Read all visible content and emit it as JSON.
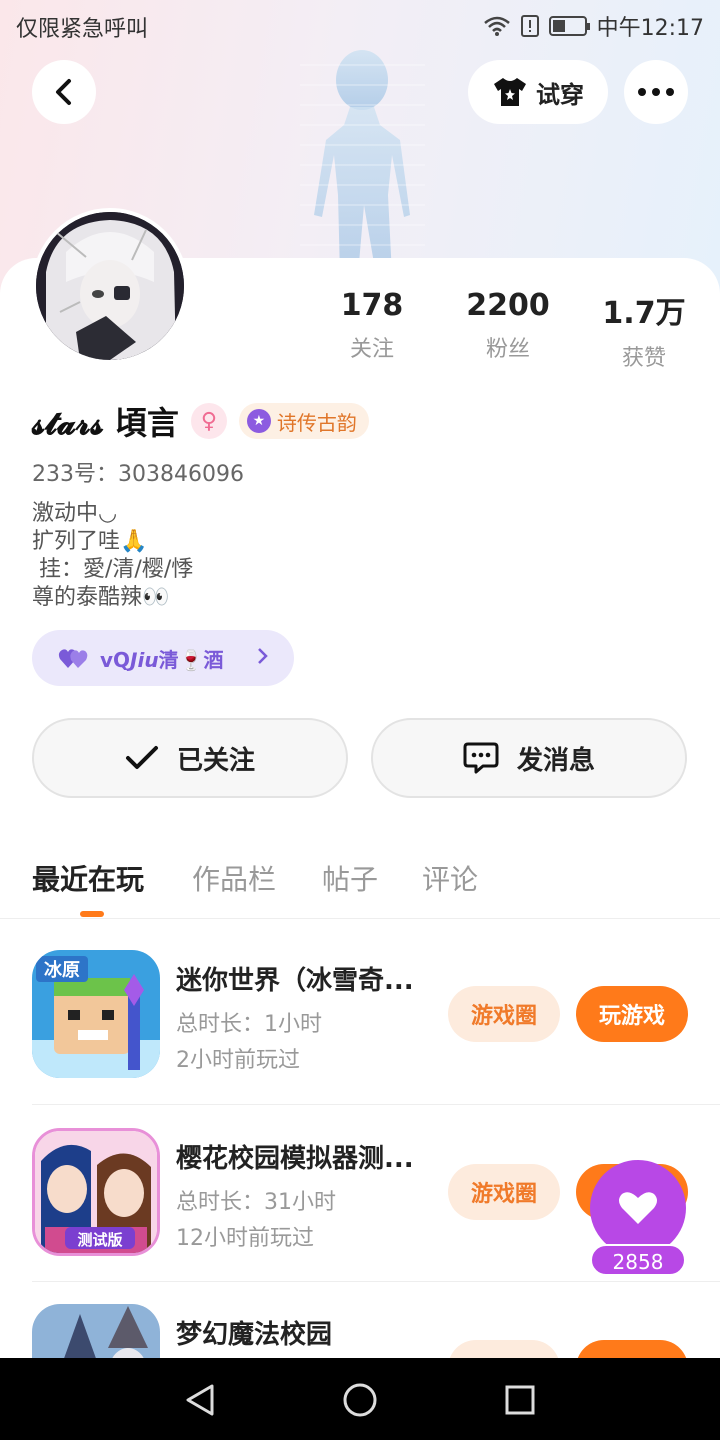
{
  "status_bar": {
    "carrier": "仅限紧急呼叫",
    "time": "中午12:17"
  },
  "header": {
    "tryon_label": "试穿",
    "back_icon": "back-chevron-icon",
    "more_icon": "more-dots-icon",
    "tryon_icon": "tshirt-icon"
  },
  "profile": {
    "stats": [
      {
        "value": "178",
        "label": "关注"
      },
      {
        "value": "2200",
        "label": "粉丝"
      },
      {
        "value": "1.7万",
        "label": "获赞"
      }
    ],
    "name": "𝓼𝓽𝓪𝓻𝓼 頃言",
    "gender_symbol": "♀",
    "title_badge": "诗传古韵",
    "uid": "233号：303846096",
    "bio": "激动中◡\n扩列了哇🙏\n 挂：愛/清/樱/悸\n尊的泰酷辣👀",
    "cp_name": "vQ𝙅𝙞𝙪清🍷酒"
  },
  "actions": {
    "follow_label": "已关注",
    "message_label": "发消息"
  },
  "tabs": [
    "最近在玩",
    "作品栏",
    "帖子",
    "评论"
  ],
  "games": [
    {
      "title": "迷你世界（冰雪奇...",
      "duration": "总时长：1小时",
      "last_played": "2小时前玩过",
      "circle_label": "游戏圈",
      "play_label": "玩游戏"
    },
    {
      "title": "樱花校园模拟器测...",
      "duration": "总时长：31小时",
      "last_played": "12小时前玩过",
      "circle_label": "游戏圈",
      "play_label": "玩游戏"
    },
    {
      "title": "梦幻魔法校园",
      "duration": "",
      "last_played": "",
      "circle_label": "",
      "play_label": ""
    }
  ],
  "fab": {
    "count": "2858"
  },
  "colors": {
    "accent": "#ff7a1a",
    "purple": "#b848e6",
    "chip_bg": "#ebe8fb"
  }
}
